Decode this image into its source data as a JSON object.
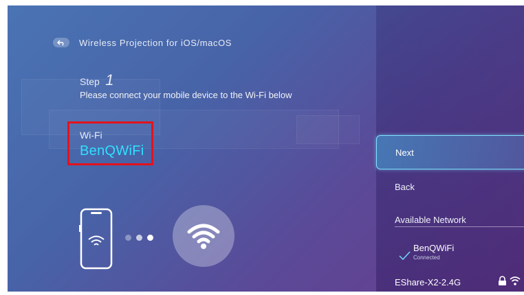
{
  "header": {
    "title": "Wireless Projection for iOS/macOS",
    "back_icon": "back-arrow-icon"
  },
  "step": {
    "label": "Step",
    "number": "1"
  },
  "instruction": "Please connect your mobile device to the Wi-Fi below",
  "wifi": {
    "label": "Wi-Fi",
    "ssid": "BenQWiFi"
  },
  "illustration": {
    "phone_icon": "phone-wifi-icon",
    "dots_icon": "connecting-dots-icon",
    "wifi_icon": "wifi-icon"
  },
  "menu": {
    "next": "Next",
    "back": "Back",
    "available_network": "Available Network",
    "networks": [
      {
        "name": "BenQWiFi",
        "status": "Connected",
        "selected": true,
        "locked": false
      },
      {
        "name": "EShare-X2-2.4G",
        "status": "",
        "selected": false,
        "locked": true
      }
    ]
  },
  "colors": {
    "highlight_border": "#e4121c",
    "ssid_text": "#2fe0ff",
    "selected_border": "#7ee3ff",
    "check_mark": "#6fd8ff"
  }
}
